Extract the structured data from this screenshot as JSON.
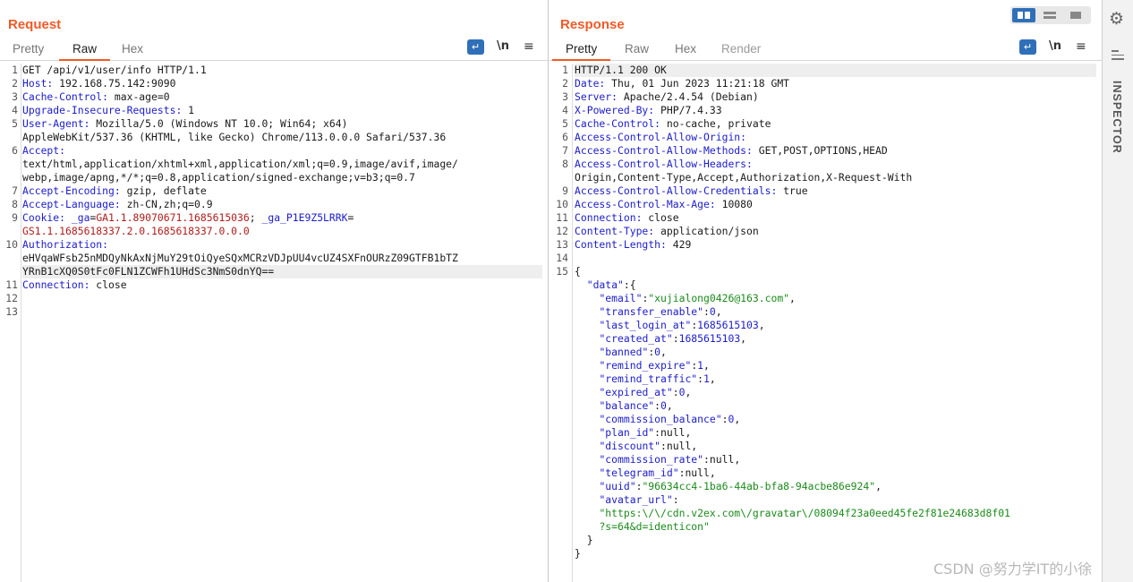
{
  "request": {
    "title": "Request",
    "tabs": [
      "Pretty",
      "Raw",
      "Hex"
    ],
    "active_tab": "Raw",
    "tools": {
      "wrap": "wrap-lines-icon",
      "newline": "\\n",
      "menu": "≡"
    },
    "lines": [
      {
        "n": "1",
        "segments": [
          {
            "t": "GET /api/v1/user/info HTTP/1.1",
            "c": ""
          }
        ]
      },
      {
        "n": "2",
        "segments": [
          {
            "t": "Host:",
            "c": "hk"
          },
          {
            "t": " 192.168.75.142:9090",
            "c": ""
          }
        ]
      },
      {
        "n": "3",
        "segments": [
          {
            "t": "Cache-Control:",
            "c": "hk"
          },
          {
            "t": " max-age=0",
            "c": ""
          }
        ]
      },
      {
        "n": "4",
        "segments": [
          {
            "t": "Upgrade-Insecure-Requests:",
            "c": "hk"
          },
          {
            "t": " 1",
            "c": ""
          }
        ]
      },
      {
        "n": "5",
        "segments": [
          {
            "t": "User-Agent:",
            "c": "hk"
          },
          {
            "t": " Mozilla/5.0 (Windows NT 10.0; Win64; x64)",
            "c": ""
          }
        ]
      },
      {
        "n": "",
        "segments": [
          {
            "t": "AppleWebKit/537.36 (KHTML, like Gecko) Chrome/113.0.0.0 Safari/537.36",
            "c": ""
          }
        ]
      },
      {
        "n": "6",
        "segments": [
          {
            "t": "Accept:",
            "c": "hk"
          }
        ]
      },
      {
        "n": "",
        "segments": [
          {
            "t": "text/html,application/xhtml+xml,application/xml;q=0.9,image/avif,image/",
            "c": ""
          }
        ]
      },
      {
        "n": "",
        "segments": [
          {
            "t": "webp,image/apng,*/*;q=0.8,application/signed-exchange;v=b3;q=0.7",
            "c": ""
          }
        ]
      },
      {
        "n": "7",
        "segments": [
          {
            "t": "Accept-Encoding:",
            "c": "hk"
          },
          {
            "t": " gzip, deflate",
            "c": ""
          }
        ]
      },
      {
        "n": "8",
        "segments": [
          {
            "t": "Accept-Language:",
            "c": "hk"
          },
          {
            "t": " zh-CN,zh;q=0.9",
            "c": ""
          }
        ]
      },
      {
        "n": "9",
        "segments": [
          {
            "t": "Cookie:",
            "c": "hk"
          },
          {
            "t": " _ga",
            "c": "ck"
          },
          {
            "t": "=",
            "c": ""
          },
          {
            "t": "GA1.1.89070671.1685615036",
            "c": "cv"
          },
          {
            "t": "; ",
            "c": ""
          },
          {
            "t": "_ga_P1E9Z5LRRK",
            "c": "ck"
          },
          {
            "t": "=",
            "c": ""
          }
        ]
      },
      {
        "n": "",
        "segments": [
          {
            "t": "GS1.1.1685618337.2.0.1685618337.0.0.0",
            "c": "cv"
          }
        ]
      },
      {
        "n": "10",
        "segments": [
          {
            "t": "Authorization:",
            "c": "hk"
          }
        ]
      },
      {
        "n": "",
        "segments": [
          {
            "t": "eHVqaWFsb25nMDQyNkAxNjMuY29tOiQyeSQxMCRzVDJpUU4vcUZ4SXFnOURzZ09GTFB1bTZ",
            "c": ""
          }
        ]
      },
      {
        "n": "",
        "hl": true,
        "segments": [
          {
            "t": "YRnB1cXQ0S0tFc0FLN1ZCWFh1UHdSc3NmS0dnYQ==",
            "c": ""
          }
        ]
      },
      {
        "n": "11",
        "segments": [
          {
            "t": "Connection:",
            "c": "hk"
          },
          {
            "t": " close",
            "c": ""
          }
        ]
      },
      {
        "n": "12",
        "segments": []
      },
      {
        "n": "13",
        "segments": []
      }
    ]
  },
  "response": {
    "title": "Response",
    "tabs": [
      "Pretty",
      "Raw",
      "Hex",
      "Render"
    ],
    "active_tab": "Pretty",
    "tools": {
      "wrap": "wrap-lines-icon",
      "newline": "\\n",
      "menu": "≡"
    },
    "lines": [
      {
        "n": "1",
        "hl": true,
        "segments": [
          {
            "t": "HTTP/1.1 200 OK",
            "c": ""
          }
        ]
      },
      {
        "n": "2",
        "segments": [
          {
            "t": "Date:",
            "c": "hk"
          },
          {
            "t": " Thu, 01 Jun 2023 11:21:18 GMT",
            "c": ""
          }
        ]
      },
      {
        "n": "3",
        "segments": [
          {
            "t": "Server:",
            "c": "hk"
          },
          {
            "t": " Apache/2.4.54 (Debian)",
            "c": ""
          }
        ]
      },
      {
        "n": "4",
        "segments": [
          {
            "t": "X-Powered-By:",
            "c": "hk"
          },
          {
            "t": " PHP/7.4.33",
            "c": ""
          }
        ]
      },
      {
        "n": "5",
        "segments": [
          {
            "t": "Cache-Control:",
            "c": "hk"
          },
          {
            "t": " no-cache, private",
            "c": ""
          }
        ]
      },
      {
        "n": "6",
        "segments": [
          {
            "t": "Access-Control-Allow-Origin:",
            "c": "hk"
          }
        ]
      },
      {
        "n": "7",
        "segments": [
          {
            "t": "Access-Control-Allow-Methods:",
            "c": "hk"
          },
          {
            "t": " GET,POST,OPTIONS,HEAD",
            "c": ""
          }
        ]
      },
      {
        "n": "8",
        "segments": [
          {
            "t": "Access-Control-Allow-Headers:",
            "c": "hk"
          }
        ]
      },
      {
        "n": "",
        "segments": [
          {
            "t": "Origin,Content-Type,Accept,Authorization,X-Request-With",
            "c": ""
          }
        ]
      },
      {
        "n": "9",
        "segments": [
          {
            "t": "Access-Control-Allow-Credentials:",
            "c": "hk"
          },
          {
            "t": " true",
            "c": ""
          }
        ]
      },
      {
        "n": "10",
        "segments": [
          {
            "t": "Access-Control-Max-Age:",
            "c": "hk"
          },
          {
            "t": " 10080",
            "c": ""
          }
        ]
      },
      {
        "n": "11",
        "segments": [
          {
            "t": "Connection:",
            "c": "hk"
          },
          {
            "t": " close",
            "c": ""
          }
        ]
      },
      {
        "n": "12",
        "segments": [
          {
            "t": "Content-Type:",
            "c": "hk"
          },
          {
            "t": " application/json",
            "c": ""
          }
        ]
      },
      {
        "n": "13",
        "segments": [
          {
            "t": "Content-Length:",
            "c": "hk"
          },
          {
            "t": " 429",
            "c": ""
          }
        ]
      },
      {
        "n": "14",
        "segments": []
      },
      {
        "n": "15",
        "segments": [
          {
            "t": "{",
            "c": ""
          }
        ]
      },
      {
        "n": "",
        "segments": [
          {
            "t": "  ",
            "c": ""
          },
          {
            "t": "\"data\"",
            "c": "jk"
          },
          {
            "t": ":{",
            "c": ""
          }
        ]
      },
      {
        "n": "",
        "segments": [
          {
            "t": "    ",
            "c": ""
          },
          {
            "t": "\"email\"",
            "c": "jk"
          },
          {
            "t": ":",
            "c": ""
          },
          {
            "t": "\"xujialong0426@163.com\"",
            "c": "js"
          },
          {
            "t": ",",
            "c": ""
          }
        ]
      },
      {
        "n": "",
        "segments": [
          {
            "t": "    ",
            "c": ""
          },
          {
            "t": "\"transfer_enable\"",
            "c": "jk"
          },
          {
            "t": ":",
            "c": ""
          },
          {
            "t": "0",
            "c": "jn"
          },
          {
            "t": ",",
            "c": ""
          }
        ]
      },
      {
        "n": "",
        "segments": [
          {
            "t": "    ",
            "c": ""
          },
          {
            "t": "\"last_login_at\"",
            "c": "jk"
          },
          {
            "t": ":",
            "c": ""
          },
          {
            "t": "1685615103",
            "c": "jn"
          },
          {
            "t": ",",
            "c": ""
          }
        ]
      },
      {
        "n": "",
        "segments": [
          {
            "t": "    ",
            "c": ""
          },
          {
            "t": "\"created_at\"",
            "c": "jk"
          },
          {
            "t": ":",
            "c": ""
          },
          {
            "t": "1685615103",
            "c": "jn"
          },
          {
            "t": ",",
            "c": ""
          }
        ]
      },
      {
        "n": "",
        "segments": [
          {
            "t": "    ",
            "c": ""
          },
          {
            "t": "\"banned\"",
            "c": "jk"
          },
          {
            "t": ":",
            "c": ""
          },
          {
            "t": "0",
            "c": "jn"
          },
          {
            "t": ",",
            "c": ""
          }
        ]
      },
      {
        "n": "",
        "segments": [
          {
            "t": "    ",
            "c": ""
          },
          {
            "t": "\"remind_expire\"",
            "c": "jk"
          },
          {
            "t": ":",
            "c": ""
          },
          {
            "t": "1",
            "c": "jn"
          },
          {
            "t": ",",
            "c": ""
          }
        ]
      },
      {
        "n": "",
        "segments": [
          {
            "t": "    ",
            "c": ""
          },
          {
            "t": "\"remind_traffic\"",
            "c": "jk"
          },
          {
            "t": ":",
            "c": ""
          },
          {
            "t": "1",
            "c": "jn"
          },
          {
            "t": ",",
            "c": ""
          }
        ]
      },
      {
        "n": "",
        "segments": [
          {
            "t": "    ",
            "c": ""
          },
          {
            "t": "\"expired_at\"",
            "c": "jk"
          },
          {
            "t": ":",
            "c": ""
          },
          {
            "t": "0",
            "c": "jn"
          },
          {
            "t": ",",
            "c": ""
          }
        ]
      },
      {
        "n": "",
        "segments": [
          {
            "t": "    ",
            "c": ""
          },
          {
            "t": "\"balance\"",
            "c": "jk"
          },
          {
            "t": ":",
            "c": ""
          },
          {
            "t": "0",
            "c": "jn"
          },
          {
            "t": ",",
            "c": ""
          }
        ]
      },
      {
        "n": "",
        "segments": [
          {
            "t": "    ",
            "c": ""
          },
          {
            "t": "\"commission_balance\"",
            "c": "jk"
          },
          {
            "t": ":",
            "c": ""
          },
          {
            "t": "0",
            "c": "jn"
          },
          {
            "t": ",",
            "c": ""
          }
        ]
      },
      {
        "n": "",
        "segments": [
          {
            "t": "    ",
            "c": ""
          },
          {
            "t": "\"plan_id\"",
            "c": "jk"
          },
          {
            "t": ":null,",
            "c": ""
          }
        ]
      },
      {
        "n": "",
        "segments": [
          {
            "t": "    ",
            "c": ""
          },
          {
            "t": "\"discount\"",
            "c": "jk"
          },
          {
            "t": ":null,",
            "c": ""
          }
        ]
      },
      {
        "n": "",
        "segments": [
          {
            "t": "    ",
            "c": ""
          },
          {
            "t": "\"commission_rate\"",
            "c": "jk"
          },
          {
            "t": ":null,",
            "c": ""
          }
        ]
      },
      {
        "n": "",
        "segments": [
          {
            "t": "    ",
            "c": ""
          },
          {
            "t": "\"telegram_id\"",
            "c": "jk"
          },
          {
            "t": ":null,",
            "c": ""
          }
        ]
      },
      {
        "n": "",
        "segments": [
          {
            "t": "    ",
            "c": ""
          },
          {
            "t": "\"uuid\"",
            "c": "jk"
          },
          {
            "t": ":",
            "c": ""
          },
          {
            "t": "\"96634cc4-1ba6-44ab-bfa8-94acbe86e924\"",
            "c": "js"
          },
          {
            "t": ",",
            "c": ""
          }
        ]
      },
      {
        "n": "",
        "segments": [
          {
            "t": "    ",
            "c": ""
          },
          {
            "t": "\"avatar_url\"",
            "c": "jk"
          },
          {
            "t": ":",
            "c": ""
          }
        ]
      },
      {
        "n": "",
        "segments": [
          {
            "t": "    ",
            "c": ""
          },
          {
            "t": "\"https:\\/\\/cdn.v2ex.com\\/gravatar\\/08094f23a0eed45fe2f81e24683d8f01",
            "c": "js"
          }
        ]
      },
      {
        "n": "",
        "segments": [
          {
            "t": "    ",
            "c": ""
          },
          {
            "t": "?s=64&d=identicon\"",
            "c": "js"
          }
        ]
      },
      {
        "n": "",
        "segments": [
          {
            "t": "  }",
            "c": ""
          }
        ]
      },
      {
        "n": "",
        "segments": [
          {
            "t": "}",
            "c": ""
          }
        ]
      }
    ]
  },
  "inspector": {
    "label": "INSPECTOR"
  },
  "watermark": "CSDN @努力学IT的小徐",
  "colors": {
    "accent": "#f05a28",
    "toolbar_blue": "#2f6fb8",
    "header_key": "#1c1ccc",
    "cookie_value": "#b01c1c",
    "json_string": "#1b8a1b"
  }
}
